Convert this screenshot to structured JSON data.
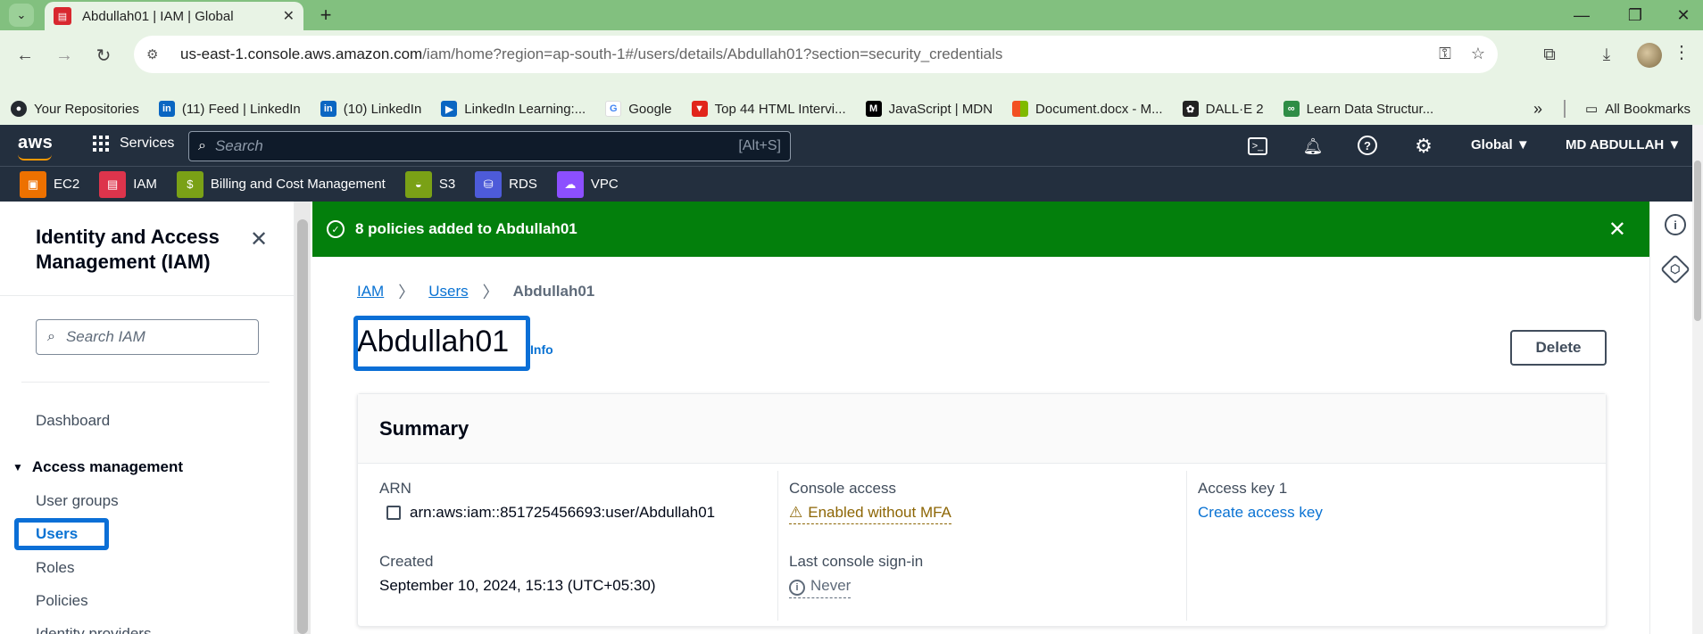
{
  "browser": {
    "tab_title": "Abdullah01 | IAM | Global",
    "url_host": "us-east-1.console.aws.amazon.com",
    "url_path": "/iam/home?region=ap-south-1#/users/details/Abdullah01?section=security_credentials",
    "bookmarks": [
      {
        "label": "Your Repositories",
        "icon": "github-icon",
        "color": "#24292f"
      },
      {
        "label": "(11) Feed | LinkedIn",
        "icon": "linkedin-icon",
        "color": "#0a66c2"
      },
      {
        "label": "(10) LinkedIn",
        "icon": "linkedin-icon",
        "color": "#0a66c2"
      },
      {
        "label": "LinkedIn Learning:...",
        "icon": "linkedin-learning-icon",
        "color": "#0a66c2"
      },
      {
        "label": "Google",
        "icon": "google-icon",
        "color": "#4285f4"
      },
      {
        "label": "Top 44 HTML Intervi...",
        "icon": "bookmark-red-icon",
        "color": "#e1251b"
      },
      {
        "label": "JavaScript | MDN",
        "icon": "mdn-icon",
        "color": "#000000"
      },
      {
        "label": "Document.docx - M...",
        "icon": "microsoft-icon",
        "color": "#f25022"
      },
      {
        "label": "DALL·E 2",
        "icon": "openai-icon",
        "color": "#222222"
      },
      {
        "label": "Learn Data Structur...",
        "icon": "gfg-icon",
        "color": "#2f8d46"
      }
    ],
    "all_bookmarks": "All Bookmarks"
  },
  "aws": {
    "logo": "aws",
    "services": "Services",
    "search_placeholder": "Search",
    "search_shortcut": "[Alt+S]",
    "region": "Global",
    "account": "MD ABDULLAH",
    "favorites": [
      {
        "label": "EC2",
        "icon": "ec2-icon",
        "color": "#ed7100"
      },
      {
        "label": "IAM",
        "icon": "iam-icon",
        "color": "#dd344c"
      },
      {
        "label": "Billing and Cost Management",
        "icon": "billing-icon",
        "color": "#7aa116"
      },
      {
        "label": "S3",
        "icon": "s3-icon",
        "color": "#7aa116"
      },
      {
        "label": "RDS",
        "icon": "rds-icon",
        "color": "#4d5bd9"
      },
      {
        "label": "VPC",
        "icon": "vpc-icon",
        "color": "#8c4fff"
      }
    ]
  },
  "sidenav": {
    "title": "Identity and Access Management (IAM)",
    "search_placeholder": "Search IAM",
    "dashboard": "Dashboard",
    "section": "Access management",
    "items": [
      "User groups",
      "Users",
      "Roles",
      "Policies",
      "Identity providers"
    ]
  },
  "flash": {
    "message": "8 policies added to Abdullah01"
  },
  "breadcrumb": {
    "iam": "IAM",
    "users": "Users",
    "current": "Abdullah01"
  },
  "page": {
    "title": "Abdullah01",
    "info": "Info",
    "delete": "Delete"
  },
  "summary": {
    "heading": "Summary",
    "arn_label": "ARN",
    "arn_value": "arn:aws:iam::851725456693:user/Abdullah01",
    "created_label": "Created",
    "created_value": "September 10, 2024, 15:13 (UTC+05:30)",
    "console_label": "Console access",
    "console_value": "Enabled without MFA",
    "signin_label": "Last console sign-in",
    "signin_value": "Never",
    "access_key_label": "Access key 1",
    "access_key_value": "Create access key"
  },
  "colors": {
    "flash_bg": "#037f0c",
    "link": "#0972d3",
    "warning": "#8d6605",
    "annotation": "#0b6fd6"
  }
}
